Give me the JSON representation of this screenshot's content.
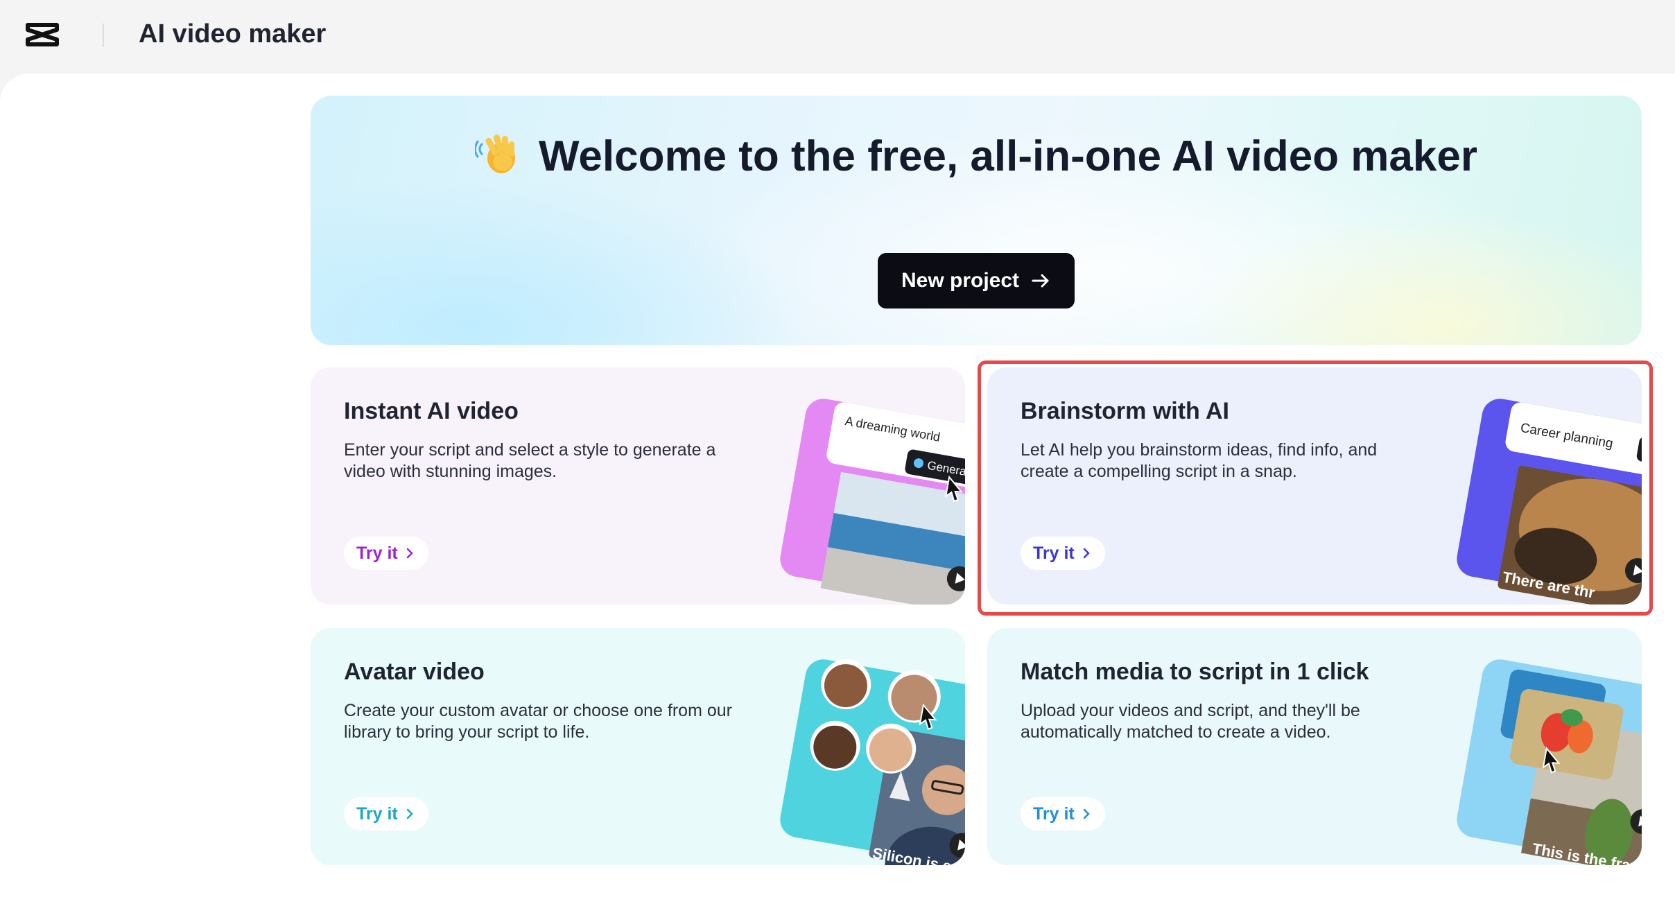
{
  "app": {
    "title": "AI video maker",
    "logo_icon": "capcut-logo-icon"
  },
  "hero": {
    "emoji_icon": "waving-hand-icon",
    "title": "Welcome to the free, all-in-one AI video maker",
    "button_label": "New project"
  },
  "cards": [
    {
      "title": "Instant AI video",
      "description": "Enter your script and select a style to generate a video with stunning images.",
      "try_label": "Try it",
      "accent": "#a21fd4",
      "preview": {
        "prompt_text": "A dreaming world",
        "button_text": "Generate"
      }
    },
    {
      "title": "Brainstorm with AI",
      "description": "Let AI help you brainstorm ideas, find info, and create a compelling script in a snap.",
      "try_label": "Try it",
      "accent": "#3a36d6",
      "highlighted": true,
      "preview": {
        "prompt_text": "Career planning",
        "caption": "There are thr"
      }
    },
    {
      "title": "Avatar video",
      "description": "Create your custom avatar or choose one from our library to bring your script to life.",
      "try_label": "Try it",
      "accent": "#18a9c8",
      "preview": {
        "caption": "Silicon is es"
      }
    },
    {
      "title": "Match media to script in 1 click",
      "description": "Upload your videos and script, and they'll be automatically matched to create a video.",
      "try_label": "Try it",
      "accent": "#1f8fd8",
      "preview": {
        "caption": "This is the fra"
      }
    }
  ],
  "colors": {
    "highlight_border": "#e8484a",
    "primary_button": "#0c0d14"
  }
}
